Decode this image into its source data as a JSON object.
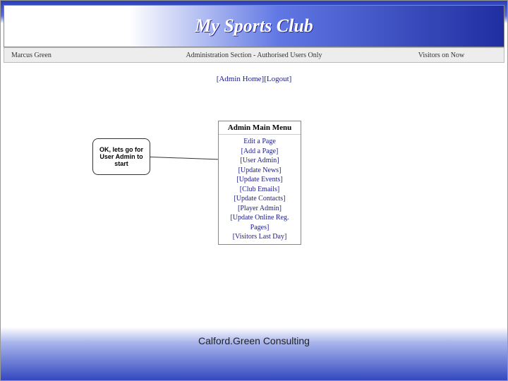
{
  "banner": {
    "title": "My Sports Club"
  },
  "subbar": {
    "left": "Marcus Green",
    "center": "Administration Section - Authorised Users Only",
    "right": "Visitors on Now"
  },
  "nav": {
    "admin_home": "[Admin Home]",
    "logout": "[Logout]"
  },
  "menu": {
    "title": "Admin Main Menu",
    "items": [
      "Edit a Page",
      "[Add a Page]",
      "[User Admin]",
      "[Update News]",
      "[Update Events]",
      "[Club Emails]",
      "[Update Contacts]",
      "[Player Admin]",
      "[Update Online Reg. Pages]",
      "[Visitors Last Day]"
    ]
  },
  "callout": {
    "text": "OK, lets go for User Admin to start"
  },
  "footer": {
    "text": "Calford.Green Consulting"
  }
}
